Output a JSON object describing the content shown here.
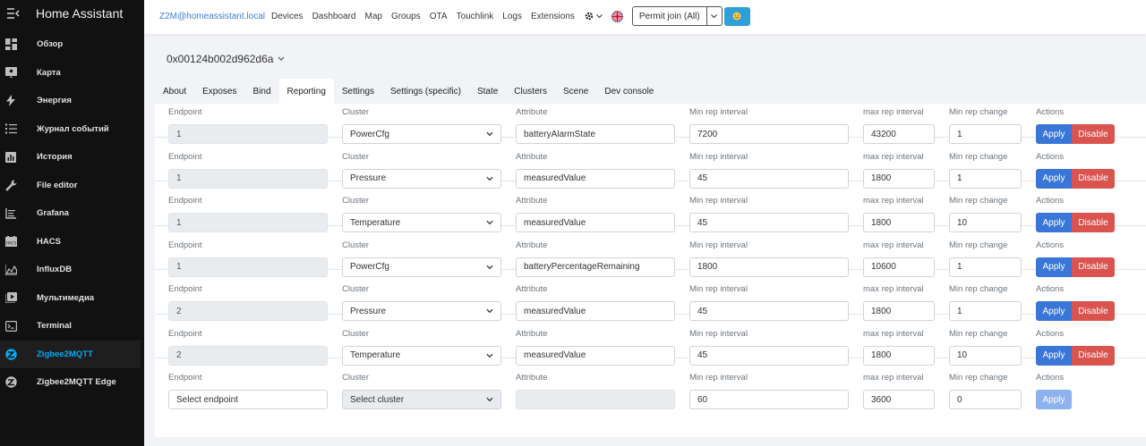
{
  "sidebar": {
    "title": "Home Assistant",
    "items": [
      {
        "label": "Обзор",
        "icon": "dashboard-icon"
      },
      {
        "label": "Карта",
        "icon": "map-icon"
      },
      {
        "label": "Энергия",
        "icon": "lightning-icon"
      },
      {
        "label": "Журнал событий",
        "icon": "list-icon"
      },
      {
        "label": "История",
        "icon": "chart-icon"
      },
      {
        "label": "File editor",
        "icon": "wrench-icon"
      },
      {
        "label": "Grafana",
        "icon": "grafana-icon"
      },
      {
        "label": "HACS",
        "icon": "hacs-icon"
      },
      {
        "label": "InfluxDB",
        "icon": "area-chart-icon"
      },
      {
        "label": "Мультимедиа",
        "icon": "play-icon"
      },
      {
        "label": "Terminal",
        "icon": "terminal-icon"
      },
      {
        "label": "Zigbee2MQTT",
        "icon": "zigbee-icon",
        "active": true
      },
      {
        "label": "Zigbee2MQTT Edge",
        "icon": "zigbee-icon"
      }
    ]
  },
  "topnav": {
    "brand": "Z2M@homeassistant.local",
    "links": [
      "Devices",
      "Dashboard",
      "Map",
      "Groups",
      "OTA",
      "Touchlink",
      "Logs",
      "Extensions"
    ],
    "permit_join": "Permit join (All)"
  },
  "device": {
    "name": "0x00124b002d962d6a"
  },
  "tabs": [
    "About",
    "Exposes",
    "Bind",
    "Reporting",
    "Settings",
    "Settings (specific)",
    "State",
    "Clusters",
    "Scene",
    "Dev console"
  ],
  "active_tab": "Reporting",
  "columns": {
    "endpoint": "Endpoint",
    "cluster": "Cluster",
    "attribute": "Attribute",
    "min_interval": "Min rep interval",
    "max_interval": "max rep interval",
    "min_change": "Min rep change",
    "actions": "Actions"
  },
  "buttons": {
    "apply": "Apply",
    "disable": "Disable"
  },
  "rows": [
    {
      "endpoint": "1",
      "cluster": "PowerCfg",
      "attribute": "batteryAlarmState",
      "min_interval": "7200",
      "max_interval": "43200",
      "min_change": "1"
    },
    {
      "endpoint": "1",
      "cluster": "Pressure",
      "attribute": "measuredValue",
      "min_interval": "45",
      "max_interval": "1800",
      "min_change": "1"
    },
    {
      "endpoint": "1",
      "cluster": "Temperature",
      "attribute": "measuredValue",
      "min_interval": "45",
      "max_interval": "1800",
      "min_change": "10"
    },
    {
      "endpoint": "1",
      "cluster": "PowerCfg",
      "attribute": "batteryPercentageRemaining",
      "min_interval": "1800",
      "max_interval": "10600",
      "min_change": "1"
    },
    {
      "endpoint": "2",
      "cluster": "Pressure",
      "attribute": "measuredValue",
      "min_interval": "45",
      "max_interval": "1800",
      "min_change": "1"
    },
    {
      "endpoint": "2",
      "cluster": "Temperature",
      "attribute": "measuredValue",
      "min_interval": "45",
      "max_interval": "1800",
      "min_change": "10"
    }
  ],
  "new_row": {
    "endpoint_placeholder": "Select endpoint",
    "cluster_placeholder": "Select cluster",
    "attribute": "",
    "min_interval": "60",
    "max_interval": "3600",
    "min_change": "0"
  },
  "colors": {
    "accent": "#03a9f4",
    "apply": "#3a76d8",
    "disable": "#d9534f",
    "sidebar": "#111111"
  }
}
